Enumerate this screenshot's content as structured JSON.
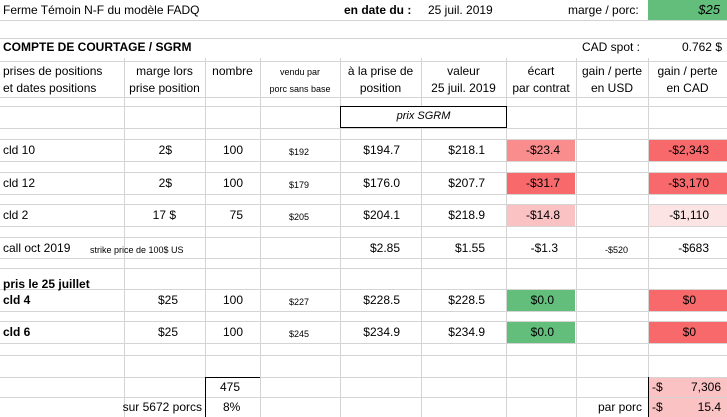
{
  "header": {
    "farm_label": "Ferme Témoin  N-F du modèle FADQ",
    "date_label": "en date du :",
    "date_value": "25 juil. 2019",
    "margin_label": "marge / porc:",
    "margin_value": "$25",
    "account_title": "COMPTE DE COURTAGE / SGRM",
    "cad_spot_label": "CAD spot :",
    "cad_spot_value": "0.762 $"
  },
  "columns": {
    "c1a": "prises de positions",
    "c1b": "et dates positions",
    "c2a": "marge lors",
    "c2b": "prise position",
    "c3a": "nombre",
    "c4a": "vendu par",
    "c4b": "porc sans base",
    "c5a": "à la prise de",
    "c5b": "position",
    "c6a": "valeur",
    "c6b": "25 juil. 2019",
    "c7a": "écart",
    "c7b": "par contrat",
    "c8a": "gain / perte",
    "c8b": "en USD",
    "c9a": "gain / perte",
    "c9b": "en CAD"
  },
  "prix_label": "prix SGRM",
  "rows": {
    "r1": {
      "pos": "cld 10",
      "marge": "2$",
      "nombre": "100",
      "vendu": "$192",
      "prise": "$194.7",
      "valeur": "$218.1",
      "ecart": "-$23.4",
      "usd": "",
      "cad": "-$2,343"
    },
    "r2": {
      "pos": "cld 12",
      "marge": "2$",
      "nombre": "100",
      "vendu": "$179",
      "prise": "$176.0",
      "valeur": "$207.7",
      "ecart": "-$31.7",
      "usd": "",
      "cad": "-$3,170"
    },
    "r3": {
      "pos": "cld 2",
      "marge": "17 $",
      "nombre": "75",
      "vendu": "$205",
      "prise": "$204.1",
      "valeur": "$218.9",
      "ecart": "-$14.8",
      "usd": "",
      "cad": "-$1,110"
    },
    "r4": {
      "pos": "call  oct 2019",
      "pos_small": "strike price de  100$ US",
      "marge": "",
      "nombre": "",
      "vendu": "",
      "prise": "$2.85",
      "valeur": "$1.55",
      "ecart": "-$1.3",
      "usd": "-$520",
      "cad": "-$683"
    },
    "r5": {
      "pos": "pris le 25 juillet"
    },
    "r6": {
      "pos": "cld 4",
      "marge": "$25",
      "nombre": "100",
      "vendu": "$227",
      "prise": "$228.5",
      "valeur": "$228.5",
      "ecart": "$0.0",
      "cad": "$0"
    },
    "r7": {
      "pos": "cld 6",
      "marge": "$25",
      "nombre": "100",
      "vendu": "$245",
      "prise": "$234.9",
      "valeur": "$234.9",
      "ecart": "$0.0",
      "cad": "$0"
    }
  },
  "totals": {
    "nombre_total": "475",
    "sur_label": "sur 5672 porcs",
    "pct": "8%",
    "par_porc_label": "par porc",
    "total_cad_sign": "-$",
    "total_cad": "7,306",
    "per_pig_sign": "-$",
    "per_pig": "15.4"
  },
  "colors": {
    "green": "#63be7b",
    "red": "#f8696b",
    "red_mid": "#f98c8d",
    "red_light": "#fbc2c3",
    "pink_lightest": "#fde4e4"
  }
}
